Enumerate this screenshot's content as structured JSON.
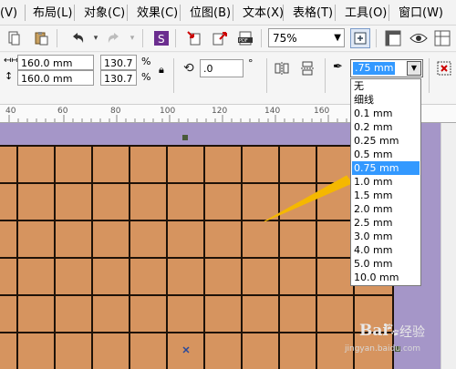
{
  "menubar": {
    "items": [
      "(V)",
      "布局(L)",
      "对象(C)",
      "效果(C)",
      "位图(B)",
      "文本(X)",
      "表格(T)",
      "工具(O)",
      "窗口(W)"
    ]
  },
  "toolbar": {
    "zoom_value": "75%"
  },
  "property_bar": {
    "width_value": "160.0 mm",
    "height_value": "160.0 mm",
    "scale_x": "130.7",
    "scale_y": "130.7",
    "percent": "%",
    "rotation_value": ".0",
    "degree_symbol": "°",
    "outline_width_value": ".75 mm"
  },
  "outline_dropdown": {
    "options": [
      "无",
      "细线",
      "0.1 mm",
      "0.2 mm",
      "0.25 mm",
      "0.5 mm",
      "0.75 mm",
      "1.0 mm",
      "1.5 mm",
      "2.0 mm",
      "2.5 mm",
      "3.0 mm",
      "4.0 mm",
      "5.0 mm",
      "10.0 mm"
    ],
    "selected": "0.75 mm"
  },
  "ruler": {
    "labels": [
      "40",
      "60",
      "80",
      "100",
      "120",
      "140",
      "160"
    ]
  },
  "canvas": {
    "background_color": "#a596c8",
    "tile_color": "#d6945f",
    "grid_line_color": "#1e1208"
  },
  "watermark": {
    "brand": "Bai",
    "text": "经验",
    "url": "jingyan.baidu.com"
  }
}
